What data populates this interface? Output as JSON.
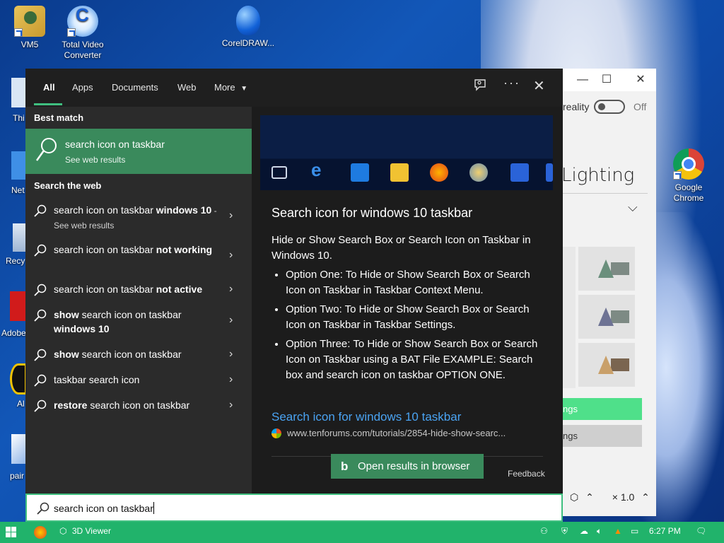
{
  "desktop": {
    "icons": [
      {
        "label": "VM5"
      },
      {
        "label": "Total Video Converter"
      },
      {
        "label": "CorelDRAW..."
      },
      {
        "label": "Google Chrome"
      }
    ],
    "edge_labels": [
      "Thi",
      "Net",
      "Recy",
      "Adobe",
      "Al",
      "pair"
    ]
  },
  "bg_window": {
    "mixed_reality_label": "reality",
    "toggle_state": "Off",
    "section_title": "Lighting",
    "green_button_label": "ngs",
    "gray_button_label": "ngs",
    "zoom_label": "× 1.0"
  },
  "search_panel": {
    "tabs": [
      {
        "label": "All",
        "active": true
      },
      {
        "label": "Apps"
      },
      {
        "label": "Documents"
      },
      {
        "label": "Web"
      },
      {
        "label": "More"
      }
    ],
    "best_match_heading": "Best match",
    "best_match": {
      "title": "search icon on taskbar",
      "subtitle": "See web results"
    },
    "search_web_heading": "Search the web",
    "results": [
      {
        "plain": "search icon on taskbar ",
        "bold": "windows 10",
        "suffix": " - See web results"
      },
      {
        "plain": "search icon on taskbar ",
        "bold": "not working",
        "suffix": ""
      },
      {
        "plain": "search icon on taskbar ",
        "bold": "not active",
        "suffix": ""
      },
      {
        "bold_prefix": "show",
        "plain": " search icon on taskbar ",
        "bold": "windows 10"
      },
      {
        "bold_prefix": "show",
        "plain": " search icon on taskbar",
        "bold": ""
      },
      {
        "plain": "taskbar search icon",
        "bold": ""
      },
      {
        "bold_prefix": "restore",
        "plain": " search icon on taskbar",
        "bold": ""
      }
    ],
    "preview": {
      "title": "Search icon for windows 10 taskbar",
      "intro": "Hide or Show Search Box or Search Icon on Taskbar in Windows 10.",
      "bullets": [
        "Option One: To Hide or Show Search Box or Search Icon on Taskbar in Taskbar Context Menu.",
        "Option Two: To Hide or Show Search Box or Search Icon on Taskbar in Taskbar Settings.",
        "Option Three: To Hide or Show Search Box or Search Icon on Taskbar using a BAT File EXAMPLE: Search box and search icon on taskbar OPTION ONE."
      ],
      "link_text": "Search icon for windows 10 taskbar",
      "url": "www.tenforums.com/tutorials/2854-hide-show-searc...",
      "open_button": "Open results in browser",
      "feedback": "Feedback"
    }
  },
  "search_box": {
    "value": "search icon on taskbar"
  },
  "taskbar": {
    "app_label": "3D Viewer",
    "time": "6:27 PM"
  },
  "colors": {
    "accent_green": "#3a8a5c",
    "taskbar_green": "#21b36b",
    "link_blue": "#4aa3f2",
    "panel_dark": "#2b2b2b"
  }
}
